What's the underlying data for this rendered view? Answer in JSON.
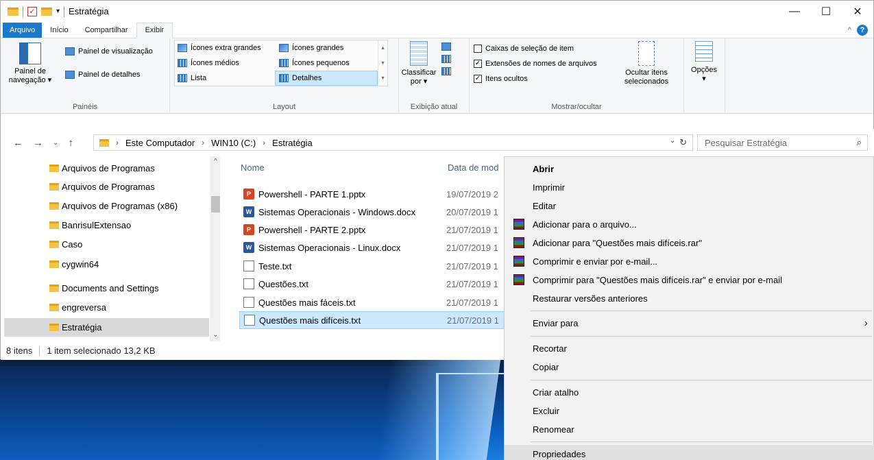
{
  "window": {
    "title": "Estratégia",
    "controls": {
      "minimize": "—",
      "maximize": "☐",
      "close": "✕"
    }
  },
  "ribbon_tabs": [
    "Arquivo",
    "Início",
    "Compartilhar",
    "Exibir"
  ],
  "ribbon": {
    "paineis": {
      "nav_pane_line1": "Painel de",
      "nav_pane_line2": "navegação",
      "preview_pane": "Painel de visualização",
      "details_pane": "Painel de detalhes",
      "label": "Painéis"
    },
    "layout": {
      "items": [
        "Ícones extra grandes",
        "Ícones grandes",
        "Ícones médios",
        "Ícones pequenos",
        "Lista",
        "Detalhes"
      ],
      "selected": "Detalhes",
      "label": "Layout"
    },
    "exibicao_atual": {
      "sort_line1": "Classificar",
      "sort_line2": "por",
      "label": "Exibição atual"
    },
    "mostrar_ocultar": {
      "checkboxes": [
        {
          "label": "Caixas de seleção de item",
          "checked": false
        },
        {
          "label": "Extensões de nomes de arquivos",
          "checked": true
        },
        {
          "label": "Itens ocultos",
          "checked": true
        }
      ],
      "hide_selected_line1": "Ocultar itens",
      "hide_selected_line2": "selecionados",
      "label": "Mostrar/ocultar"
    },
    "options": {
      "label": "Opções"
    }
  },
  "address": {
    "crumbs": [
      "Este Computador",
      "WIN10 (C:)",
      "Estratégia"
    ],
    "search_placeholder": "Pesquisar Estratégia"
  },
  "nav_pane": {
    "items": [
      "Arquivos de Programas",
      "Arquivos de Programas",
      "Arquivos de Programas (x86)",
      "BanrisulExtensao",
      "Caso",
      "cygwin64",
      "Documents and Settings",
      "engreversa",
      "Estratégia"
    ],
    "selected_index": 8
  },
  "file_list": {
    "columns": {
      "name": "Nome",
      "date": "Data de mod"
    },
    "files": [
      {
        "name": "Powershell - PARTE 1.pptx",
        "date": "19/07/2019 2",
        "type": "ppt"
      },
      {
        "name": "Sistemas Operacionais  - Windows.docx",
        "date": "20/07/2019 1",
        "type": "doc"
      },
      {
        "name": "Powershell - PARTE 2.pptx",
        "date": "21/07/2019 1",
        "type": "ppt"
      },
      {
        "name": "Sistemas Operacionais - Linux.docx",
        "date": "21/07/2019 1",
        "type": "doc"
      },
      {
        "name": "Teste.txt",
        "date": "21/07/2019 1",
        "type": "txt"
      },
      {
        "name": "Questões.txt",
        "date": "21/07/2019 1",
        "type": "txt"
      },
      {
        "name": "Questões mais fáceis.txt",
        "date": "21/07/2019 1",
        "type": "txt"
      },
      {
        "name": "Questões mais difíceis.txt",
        "date": "21/07/2019 1",
        "type": "txt"
      }
    ],
    "selected_index": 7
  },
  "status": {
    "count": "8 itens",
    "selection": "1 item selecionado  13,2 KB"
  },
  "context_menu": {
    "items": [
      "Abrir",
      "Imprimir",
      "Editar",
      "Adicionar para o arquivo...",
      "Adicionar para \"Questões mais difíceis.rar\"",
      "Comprimir e enviar por e-mail...",
      "Comprimir para \"Questões mais difíceis.rar\" e enviar por e-mail",
      "Restaurar versões anteriores",
      "Enviar para",
      "Recortar",
      "Copiar",
      "Criar atalho",
      "Excluir",
      "Renomear",
      "Propriedades"
    ],
    "hovered": "Propriedades"
  }
}
